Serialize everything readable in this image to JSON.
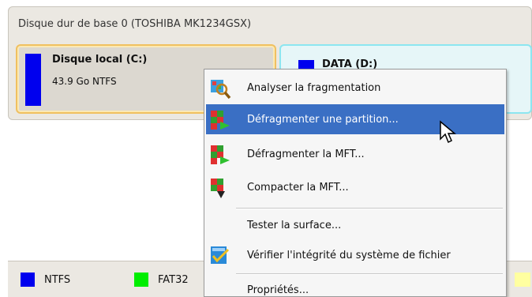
{
  "disk": {
    "title": "Disque dur de base 0 (TOSHIBA MK1234GSX)",
    "partitions": [
      {
        "name": "Disque local (C:)",
        "info": "43.9 Go NTFS",
        "color": "#0000ee",
        "state": "selected"
      },
      {
        "name": "DATA (D:)",
        "color": "#0000ee"
      }
    ]
  },
  "context_menu": {
    "items": [
      {
        "label": "Analyser la fragmentation",
        "icon": "analyze-fragmentation-icon"
      },
      {
        "label": "Défragmenter une partition...",
        "icon": "defragment-partition-icon",
        "highlighted": true
      },
      {
        "label": "Défragmenter la MFT...",
        "icon": "defragment-mft-icon"
      },
      {
        "label": "Compacter la MFT...",
        "icon": "compact-mft-icon"
      },
      {
        "label": "Tester la surface...",
        "icon": ""
      },
      {
        "label": "Vérifier l'intégrité du système de fichier",
        "icon": "check-filesystem-icon"
      },
      {
        "label": "Propriétés...",
        "icon": ""
      }
    ]
  },
  "legend": {
    "items": [
      {
        "label": "NTFS",
        "color": "#0000ee"
      },
      {
        "label": "FAT32",
        "color": "#00ee00"
      }
    ],
    "trailing_color": "#ffffa0"
  },
  "colors": {
    "highlight": "#3a6fc4",
    "panel": "#ebe8e2"
  }
}
